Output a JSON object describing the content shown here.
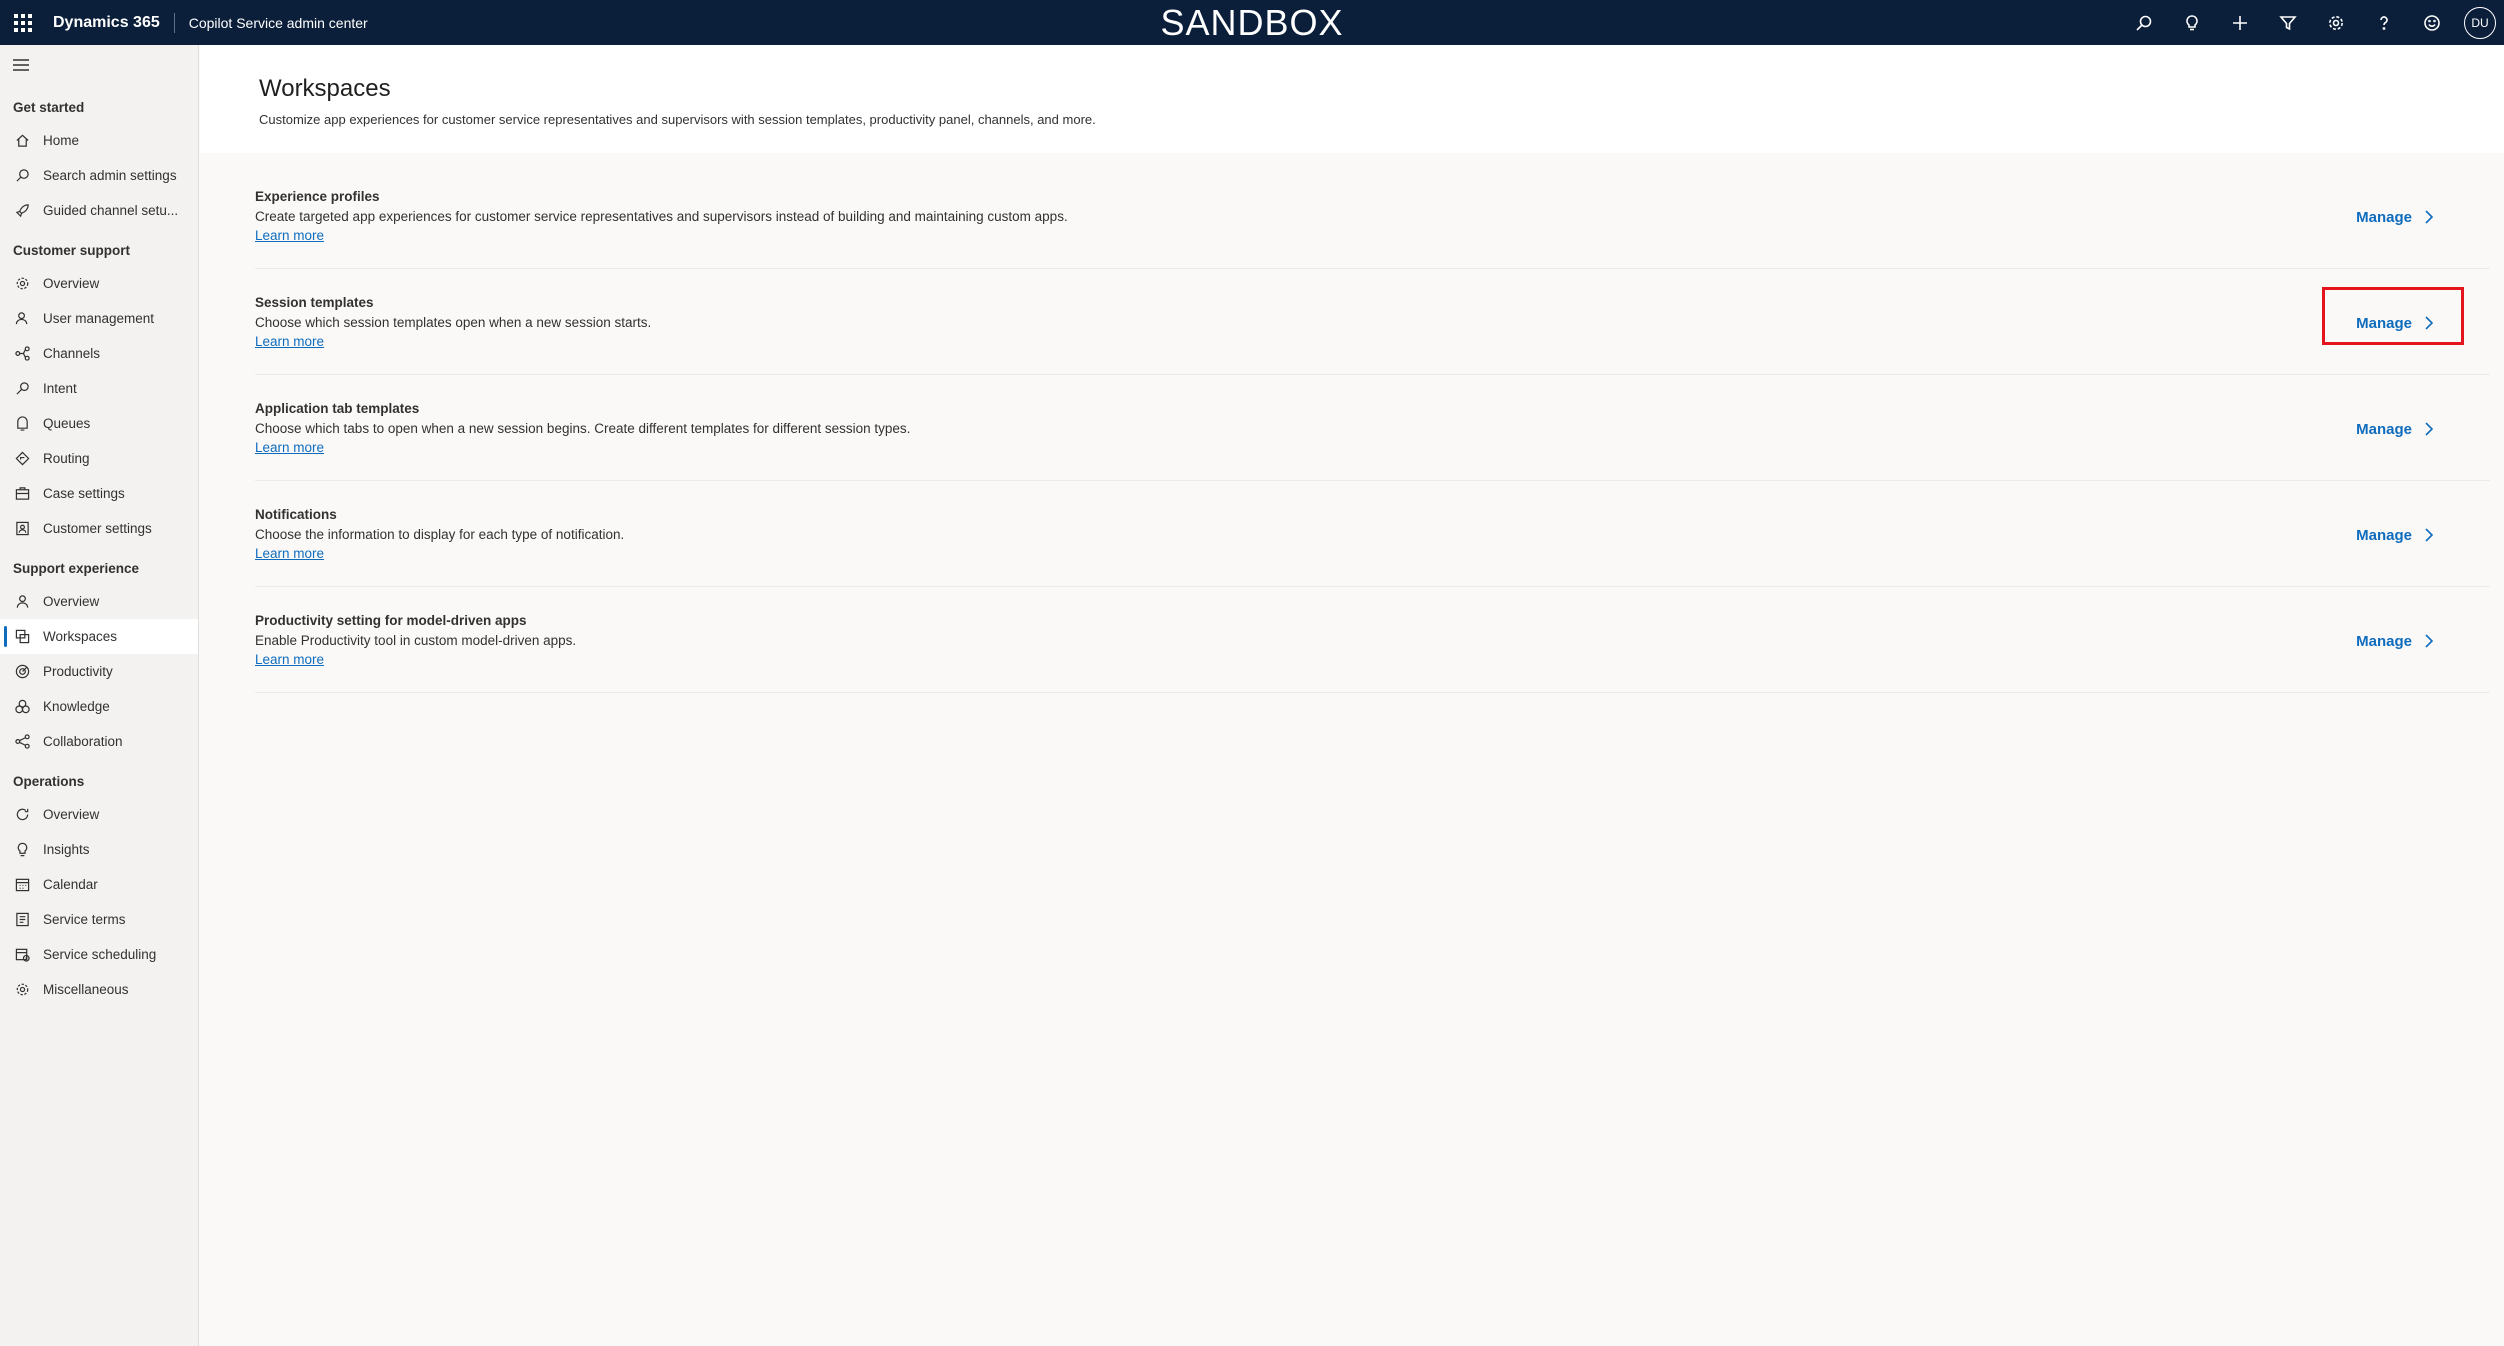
{
  "topbar": {
    "brand": "Dynamics 365",
    "app_name": "Copilot Service admin center",
    "environment_banner": "SANDBOX",
    "icons": [
      "search-icon",
      "lightbulb-icon",
      "plus-icon",
      "filter-icon",
      "settings-icon",
      "help-icon",
      "smiley-icon"
    ],
    "avatar_initials": "DU"
  },
  "sidebar": {
    "groups": [
      {
        "title": "Get started",
        "items": [
          {
            "label": "Home",
            "icon": "home-icon"
          },
          {
            "label": "Search admin settings",
            "icon": "search-icon"
          },
          {
            "label": "Guided channel setu...",
            "icon": "rocket-icon"
          }
        ]
      },
      {
        "title": "Customer support",
        "items": [
          {
            "label": "Overview",
            "icon": "gear-icon"
          },
          {
            "label": "User management",
            "icon": "user-icon"
          },
          {
            "label": "Channels",
            "icon": "channels-icon"
          },
          {
            "label": "Intent",
            "icon": "intent-icon"
          },
          {
            "label": "Queues",
            "icon": "queue-icon"
          },
          {
            "label": "Routing",
            "icon": "routing-icon"
          },
          {
            "label": "Case settings",
            "icon": "case-icon"
          },
          {
            "label": "Customer settings",
            "icon": "customer-icon"
          }
        ]
      },
      {
        "title": "Support experience",
        "items": [
          {
            "label": "Overview",
            "icon": "person-icon"
          },
          {
            "label": "Workspaces",
            "icon": "workspaces-icon",
            "active": true
          },
          {
            "label": "Productivity",
            "icon": "productivity-icon"
          },
          {
            "label": "Knowledge",
            "icon": "knowledge-icon"
          },
          {
            "label": "Collaboration",
            "icon": "collaboration-icon"
          }
        ]
      },
      {
        "title": "Operations",
        "items": [
          {
            "label": "Overview",
            "icon": "refresh-icon"
          },
          {
            "label": "Insights",
            "icon": "lightbulb-icon"
          },
          {
            "label": "Calendar",
            "icon": "calendar-icon"
          },
          {
            "label": "Service terms",
            "icon": "document-icon"
          },
          {
            "label": "Service scheduling",
            "icon": "schedule-icon"
          },
          {
            "label": "Miscellaneous",
            "icon": "gear-icon"
          }
        ]
      }
    ]
  },
  "main": {
    "title": "Workspaces",
    "subtitle": "Customize app experiences for customer service representatives and supervisors with session templates, productivity panel, channels, and more.",
    "rows": [
      {
        "title": "Experience profiles",
        "description": "Create targeted app experiences for customer service representatives and supervisors instead of building and maintaining custom apps.",
        "link": "Learn more",
        "action": "Manage"
      },
      {
        "title": "Session templates",
        "description": "Choose which session templates open when a new session starts.",
        "link": "Learn more",
        "action": "Manage",
        "highlighted": true
      },
      {
        "title": "Application tab templates",
        "description": "Choose which tabs to open when a new session begins. Create different templates for different session types.",
        "link": "Learn more",
        "action": "Manage"
      },
      {
        "title": "Notifications",
        "description": "Choose the information to display for each type of notification.",
        "link": "Learn more",
        "action": "Manage"
      },
      {
        "title": "Productivity setting for model-driven apps",
        "description": "Enable Productivity tool in custom model-driven apps.",
        "link": "Learn more",
        "action": "Manage"
      }
    ]
  },
  "colors": {
    "topbar": "#0b1f3a",
    "accent": "#0f6cbd",
    "highlight": "#e3141c"
  }
}
